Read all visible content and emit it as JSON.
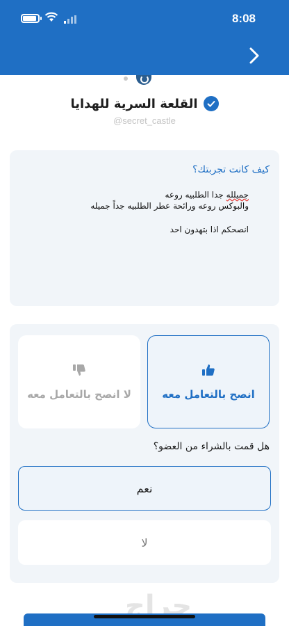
{
  "status_bar": {
    "time": "8:08",
    "battery_level": 0.9
  },
  "seller": {
    "name": "القلعة السرية للهدايا",
    "handle": "@secret_castle"
  },
  "experience": {
    "question": "كيف كانت تجربتك؟",
    "misspelled_word": "جميلله",
    "line1_rest": " جدا الطلبيه روعه",
    "line2": "والبوكس روعه ورائحة عطر الطلبيه جداً جميله",
    "line3": "انصحكم اذا بتهدون احد"
  },
  "recommend": {
    "yes_label": "انصح بالتعامل معه",
    "no_label": "لا انصح بالتعامل معه",
    "selected": "yes"
  },
  "purchase": {
    "question": "هل قمت بالشراء من العضو؟",
    "yes_label": "نعم",
    "no_label": "لا",
    "selected": "yes"
  },
  "watermark": "حراج",
  "colors": {
    "brand": "#1f6fc4",
    "card_bg": "#f1f5f9",
    "selected_bg": "#eef4fa",
    "muted": "#a8a8a8"
  },
  "icons": {
    "back": "chevron-right-icon",
    "verified": "check-circle-icon",
    "thumbs_up": "thumbs-up-icon",
    "thumbs_down": "thumbs-down-icon"
  }
}
